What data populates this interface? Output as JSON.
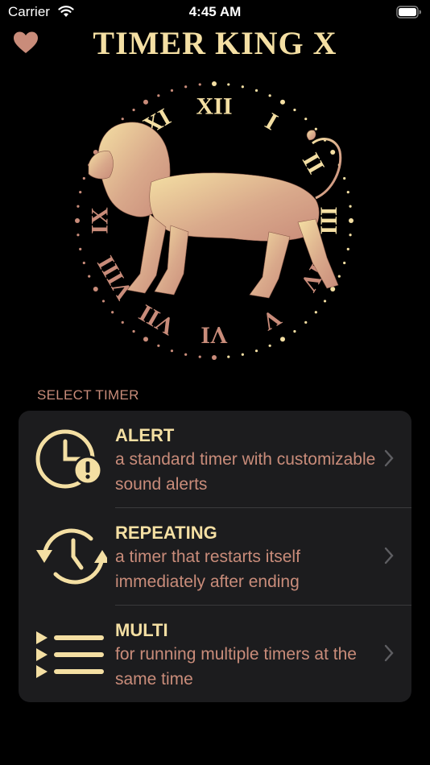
{
  "status_bar": {
    "carrier": "Carrier",
    "time": "4:45 AM"
  },
  "header": {
    "title": "TIMER KING X",
    "favorite_icon": "heart-icon"
  },
  "hero": {
    "clock_numerals": [
      "XII",
      "I",
      "II",
      "III",
      "IV",
      "V",
      "VI",
      "VII",
      "VIII",
      "IX",
      "X",
      "XI"
    ]
  },
  "section": {
    "header": "SELECT TIMER"
  },
  "timers": [
    {
      "title": "ALERT",
      "description": "a standard timer with customizable sound alerts",
      "icon": "alarm-clock-alert-icon"
    },
    {
      "title": "REPEATING",
      "description": "a timer that restarts itself immediately after ending",
      "icon": "repeat-clock-icon"
    },
    {
      "title": "MULTI",
      "description": "for running multiple timers at the same time",
      "icon": "multi-list-icon"
    }
  ],
  "colors": {
    "gold": "#f4dfa3",
    "rose": "#c98c7a",
    "card": "#1c1c1e",
    "background": "#000000"
  }
}
